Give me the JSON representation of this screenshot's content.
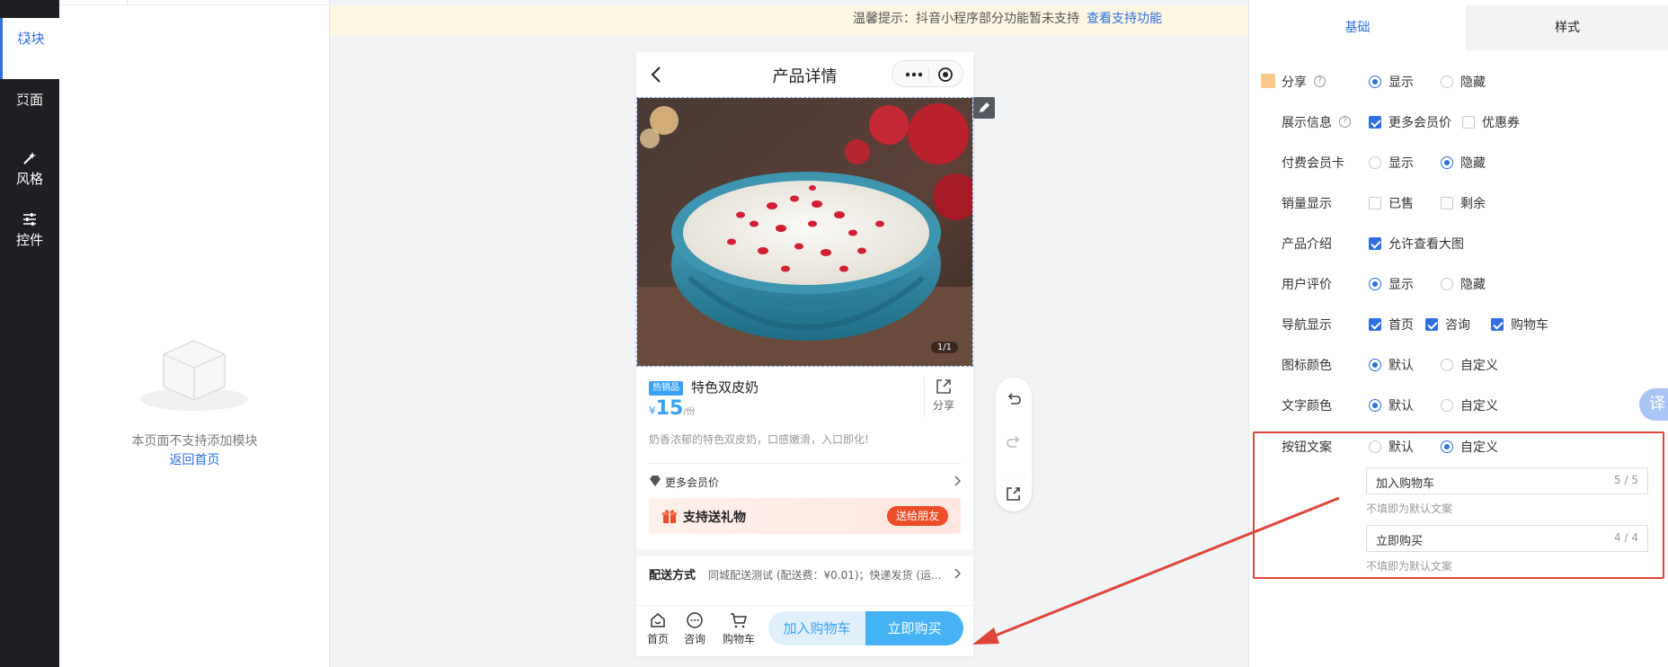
{
  "rail": {
    "items": [
      {
        "label": "模块",
        "icon": "add-square-icon"
      },
      {
        "label": "页面",
        "icon": "add-square-icon"
      },
      {
        "label": "风格",
        "icon": "magic-wand-icon"
      },
      {
        "label": "控件",
        "icon": "sliders-icon"
      }
    ]
  },
  "module_panel": {
    "empty_text": "本页面不支持添加模块",
    "back_link": "返回首页"
  },
  "notice": {
    "text": "温馨提示：抖音小程序部分功能暂未支持",
    "link": "查看支持功能"
  },
  "phone": {
    "title": "产品详情",
    "image_counter": "1/1",
    "tag": "热销品",
    "product_name": "特色双皮奶",
    "price_currency": "¥",
    "price": "15",
    "price_unit": "/份",
    "share_label": "分享",
    "description": "奶香浓郁的特色双皮奶，口感嫩滑，入口即化!",
    "member_price": "更多会员价",
    "gift_text": "支持送礼物",
    "gift_button": "送给朋友",
    "delivery_label": "配送方式",
    "delivery_value": "同城配送测试 (配送费：¥0.01)；快递发货 (运...",
    "bottom_nav": [
      "首页",
      "咨询",
      "购物车"
    ],
    "cart_button": "加入购物车",
    "buy_button": "立即购买"
  },
  "settings": {
    "tabs": [
      "基础",
      "样式"
    ],
    "rows": [
      {
        "label": "分享",
        "help": true,
        "options": [
          {
            "text": "显示",
            "type": "radio",
            "checked": true
          },
          {
            "text": "隐藏",
            "type": "radio",
            "checked": false
          }
        ]
      },
      {
        "label": "展示信息",
        "help": true,
        "options": [
          {
            "text": "更多会员价",
            "type": "checkbox",
            "checked": true
          },
          {
            "text": "优惠券",
            "type": "checkbox",
            "checked": false
          }
        ]
      },
      {
        "label": "付费会员卡",
        "help": false,
        "options": [
          {
            "text": "显示",
            "type": "radio",
            "checked": false
          },
          {
            "text": "隐藏",
            "type": "radio",
            "checked": true
          }
        ]
      },
      {
        "label": "销量显示",
        "help": false,
        "options": [
          {
            "text": "已售",
            "type": "checkbox",
            "checked": false
          },
          {
            "text": "剩余",
            "type": "checkbox",
            "checked": false
          }
        ]
      },
      {
        "label": "产品介绍",
        "help": false,
        "options": [
          {
            "text": "允许查看大图",
            "type": "checkbox",
            "checked": true
          }
        ]
      },
      {
        "label": "用户评价",
        "help": false,
        "options": [
          {
            "text": "显示",
            "type": "radio",
            "checked": true
          },
          {
            "text": "隐藏",
            "type": "radio",
            "checked": false
          }
        ]
      },
      {
        "label": "导航显示",
        "help": false,
        "options": [
          {
            "text": "首页",
            "type": "checkbox",
            "checked": true
          },
          {
            "text": "咨询",
            "type": "checkbox",
            "checked": true
          },
          {
            "text": "购物车",
            "type": "checkbox",
            "checked": true
          }
        ]
      },
      {
        "label": "图标颜色",
        "help": false,
        "options": [
          {
            "text": "默认",
            "type": "radio",
            "checked": true
          },
          {
            "text": "自定义",
            "type": "radio",
            "checked": false
          }
        ]
      },
      {
        "label": "文字颜色",
        "help": false,
        "options": [
          {
            "text": "默认",
            "type": "radio",
            "checked": true
          },
          {
            "text": "自定义",
            "type": "radio",
            "checked": false
          }
        ]
      },
      {
        "label": "按钮文案",
        "help": false,
        "options": [
          {
            "text": "默认",
            "type": "radio",
            "checked": false
          },
          {
            "text": "自定义",
            "type": "radio",
            "checked": true
          }
        ]
      }
    ],
    "cart_text_input": {
      "value": "加入购物车",
      "count": "5 / 5",
      "hint": "不填即为默认文案"
    },
    "buy_text_input": {
      "value": "立即购买",
      "count": "4 / 4",
      "hint": "不填即为默认文案"
    },
    "translate_tab": "译"
  },
  "colors": {
    "accent": "#2f6fe0",
    "button_light": "#e0f0fb",
    "button_primary": "#45b2f6",
    "annotation_red": "#e0453a"
  }
}
